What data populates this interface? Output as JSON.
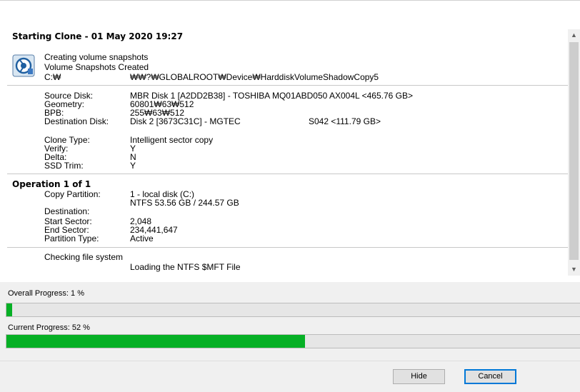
{
  "log": {
    "title": "Starting Clone - 01 May 2020  19:27",
    "snapshot": {
      "line1": "Creating volume snapshots",
      "line2": "Volume Snapshots Created",
      "drive_label": "C:₩",
      "drive_path": "₩₩?₩GLOBALROOT₩Device₩HarddiskVolumeShadowCopy5"
    },
    "disk_info": [
      {
        "label": "Source Disk:",
        "value": "MBR Disk 1 [A2DD2B38] - TOSHIBA MQ01ABD050 AX004L  <465.76 GB>"
      },
      {
        "label": "Geometry:",
        "value": "60801₩63₩512"
      },
      {
        "label": "BPB:",
        "value": "255₩63₩512"
      },
      {
        "label": "Destination Disk:",
        "value": " Disk 2 [3673C31C] - MGTEC",
        "value2": "S042  <111.79 GB>"
      }
    ],
    "clone_info": [
      {
        "label": "Clone Type:",
        "value": "Intelligent sector copy"
      },
      {
        "label": "Verify:",
        "value": "Y"
      },
      {
        "label": "Delta:",
        "value": "N"
      },
      {
        "label": "SSD Trim:",
        "value": "Y"
      }
    ],
    "operation": {
      "header": "Operation 1 of 1",
      "rows": [
        {
          "label": "Copy Partition:",
          "value": "1 - local disk (C:)"
        },
        {
          "label": "",
          "value": "NTFS 53.56 GB / 244.57 GB"
        },
        {
          "label": "Destination:",
          "value": ""
        },
        {
          "label": "Start Sector:",
          "value": "2,048"
        },
        {
          "label": "End Sector:",
          "value": "234,441,647"
        },
        {
          "label": "Partition Type:",
          "value": "Active"
        }
      ]
    },
    "status": {
      "line1": "Checking file system",
      "line2": "Loading the NTFS $MFT File"
    }
  },
  "progress": {
    "overall_label": "Overall Progress:   1 %",
    "overall_fraction": 0.01,
    "current_label": "Current Progress:  52 %",
    "current_fraction": 0.52,
    "fill_color": "#06b025"
  },
  "buttons": {
    "hide": "Hide",
    "cancel": "Cancel"
  },
  "icons": {
    "snapshot": "volume-snapshot-icon",
    "scroll_up": "scroll-up-arrow-icon",
    "scroll_down": "scroll-down-arrow-icon"
  }
}
